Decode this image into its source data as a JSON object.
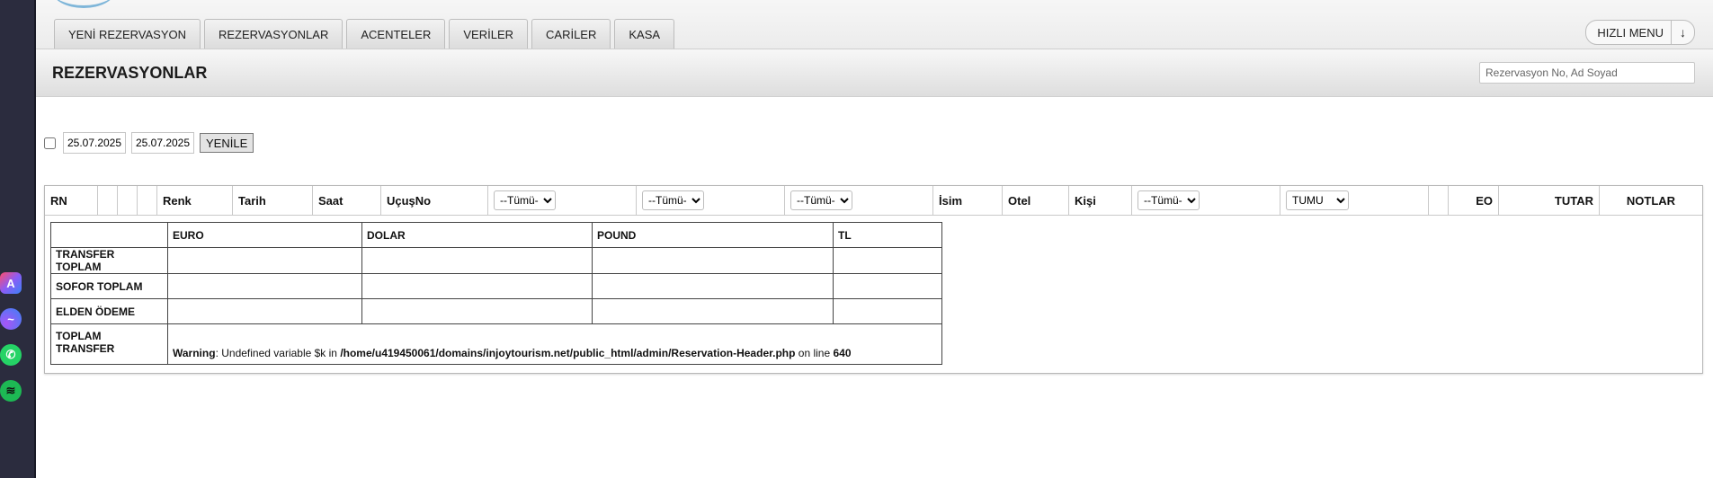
{
  "nav": {
    "tabs": [
      "YENİ REZERVASYON",
      "REZERVASYONLAR",
      "ACENTELER",
      "VERİLER",
      "CARİLER",
      "KASA"
    ],
    "quick_menu": "HIZLI MENU",
    "quick_menu_arrow": "↓"
  },
  "page": {
    "title": "REZERVASYONLAR",
    "search_placeholder": "Rezervasyon No, Ad Soyad"
  },
  "filters": {
    "date_from": "25.07.2025",
    "date_to": "25.07.2025",
    "refresh_label": "YENİLE"
  },
  "columns": {
    "rn": "RN",
    "renk": "Renk",
    "tarih": "Tarih",
    "saat": "Saat",
    "ucus_no": "UçuşNo",
    "select1": "--Tümü-",
    "select2": "--Tümü-",
    "select3": "--Tümü-",
    "isim": "İsim",
    "otel": "Otel",
    "kisi": "Kişi",
    "select4": "--Tümü-",
    "select5": "TUMU",
    "eo": "EO",
    "tutar": "TUTAR",
    "notlar": "NOTLAR"
  },
  "summary": {
    "headers": [
      "EURO",
      "DOLAR",
      "POUND",
      "TL"
    ],
    "rows": [
      "TRANSFER TOPLAM",
      "SOFOR TOPLAM",
      "ELDEN ÖDEME",
      "TOPLAM TRANSFER"
    ]
  },
  "warning": {
    "label": "Warning",
    "text_before": ": Undefined variable $k in ",
    "path": "/home/u419450061/domains/injoytourism.net/public_html/admin/Reservation-Header.php",
    "text_mid": " on line ",
    "line": "640"
  },
  "dock": {
    "apps": [
      "arc-icon",
      "messenger-icon",
      "whatsapp-icon",
      "spotify-icon"
    ]
  }
}
